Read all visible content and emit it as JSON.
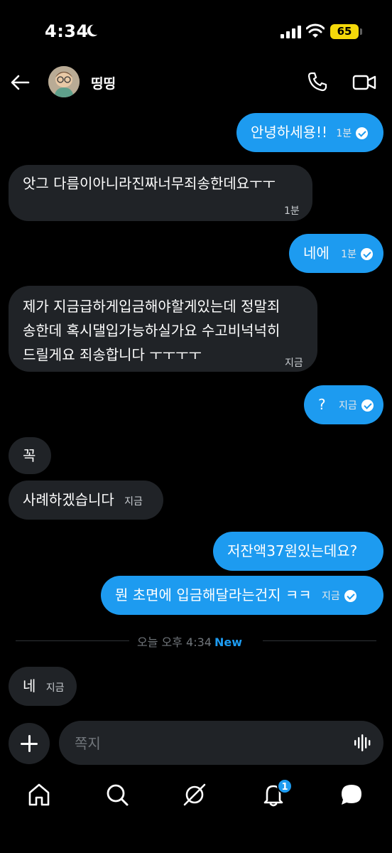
{
  "status_bar": {
    "time": "4:34",
    "battery": "65"
  },
  "header": {
    "contact_name": "띵띵"
  },
  "messages": [
    {
      "side": "out",
      "text": "안녕하세용!!",
      "time": "1분",
      "read": true
    },
    {
      "side": "in",
      "text": "앗그 다름이아니라진짜너무죄송한데요ㅜㅜ",
      "time": "1분"
    },
    {
      "side": "out",
      "text": "네에",
      "time": "1분",
      "read": true
    },
    {
      "side": "in",
      "text_lines": [
        "제가 지금급하게입금해야할게있는데 정말죄",
        "송한데 혹시댈입가능하실가요 수고비넉넉히",
        "드릴게요 죄송합니다 ㅜㅜㅜㅜ"
      ],
      "time": "지금"
    },
    {
      "side": "out",
      "text": "?",
      "time": "지금",
      "read": true
    },
    {
      "side": "in",
      "text": "꼭"
    },
    {
      "side": "in",
      "text": "사례하겠습니다",
      "time": "지금"
    },
    {
      "side": "out",
      "text": "저잔액37원있는데요?"
    },
    {
      "side": "out",
      "text": "뭔 초면에 입금해달라는건지 ㅋㅋ",
      "time": "지금",
      "read": true
    },
    {
      "side": "in",
      "text": "네",
      "time": "지금"
    }
  ],
  "divider": {
    "text": "오늘 오후 4:34",
    "new_label": "New"
  },
  "composer": {
    "placeholder": "쪽지"
  },
  "nav": {
    "notifications_badge": "1"
  },
  "colors": {
    "accent": "#1d9bf0",
    "incoming_bubble": "#202327",
    "background": "#000000"
  }
}
